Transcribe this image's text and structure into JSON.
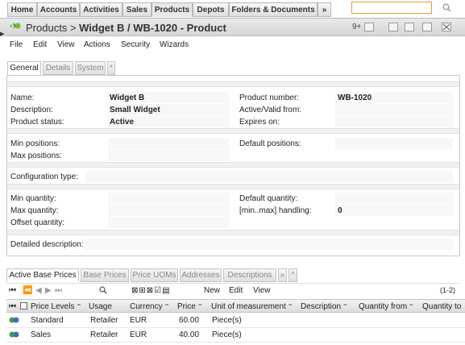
{
  "nav": {
    "tabs": [
      "Home",
      "Accounts",
      "Activities",
      "Sales",
      "Products",
      "Depots",
      "Folders & Documents",
      "»"
    ],
    "active": "Products",
    "search_value": ""
  },
  "title": {
    "module": "Products",
    "separator": ">",
    "name": "Widget B / WB-1020 - Product",
    "badge": "9+"
  },
  "menu": [
    "File",
    "Edit",
    "View",
    "Actions",
    "Security",
    "Wizards"
  ],
  "section_tabs": [
    "General",
    "Details",
    "System",
    "*"
  ],
  "form": {
    "name_label": "Name:",
    "name_value": "Widget B",
    "product_number_label": "Product number:",
    "product_number_value": "WB-1020",
    "description_label": "Description:",
    "description_value": "Small Widget",
    "active_valid_from_label": "Active/Valid from:",
    "product_status_label": "Product status:",
    "product_status_value": "Active",
    "expires_on_label": "Expires on:",
    "min_positions_label": "Min positions:",
    "default_positions_label": "Default positions:",
    "max_positions_label": "Max positions:",
    "configuration_type_label": "Configuration type:",
    "min_quantity_label": "Min quantity:",
    "default_quantity_label": "Default quantity:",
    "max_quantity_label": "Max quantity:",
    "minmax_handling_label": "[min..max] handling:",
    "minmax_handling_value": "0",
    "offset_quantity_label": "Offset quantity:",
    "detailed_description_label": "Detailed description:"
  },
  "lower_tabs": [
    "Active Base Prices",
    "Base Prices",
    "Price UOMs",
    "Addresses",
    "Descriptions",
    "»",
    "^"
  ],
  "grid_toolbar": {
    "new": "New",
    "edit": "Edit",
    "view": "View",
    "count": "(1-2)"
  },
  "table": {
    "columns": [
      "Price Levels",
      "Usage",
      "Currency",
      "Price",
      "Unit of measurement",
      "Description",
      "Quantity from",
      "Quantity to"
    ],
    "rows": [
      {
        "price_level": "Standard",
        "usage": "Retailer",
        "currency": "EUR",
        "price": "60.00",
        "uom": "Piece(s)"
      },
      {
        "price_level": "Sales",
        "usage": "Retailer",
        "currency": "EUR",
        "price": "40.00",
        "uom": "Piece(s)"
      }
    ]
  }
}
